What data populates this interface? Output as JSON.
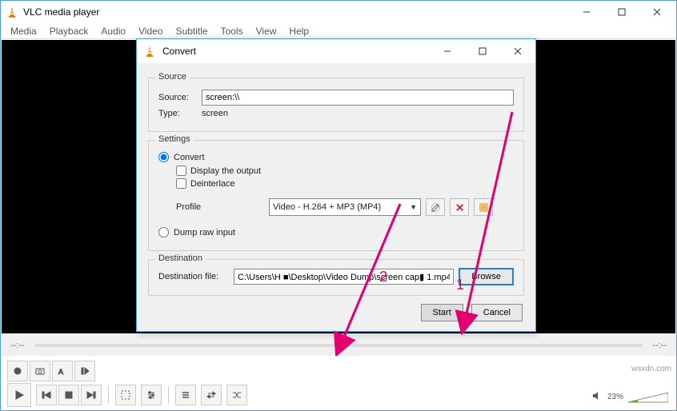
{
  "main": {
    "title": "VLC media player",
    "menu": [
      "Media",
      "Playback",
      "Audio",
      "Video",
      "Subtitle",
      "Tools",
      "View",
      "Help"
    ],
    "time_left": "--:--",
    "time_right": "--:--",
    "volume_pct": "23%"
  },
  "dialog": {
    "title": "Convert",
    "source_box": "Source",
    "source_label": "Source:",
    "source_value": "screen:\\\\",
    "type_label": "Type:",
    "type_value": "screen",
    "settings_box": "Settings",
    "convert_radio": "Convert",
    "display_output_chk": "Display the output",
    "deinterlace_chk": "Deinterlace",
    "profile_label": "Profile",
    "profile_value": "Video - H.264 + MP3 (MP4)",
    "dump_radio": "Dump raw input",
    "dest_box": "Destination",
    "dest_label": "Destination file:",
    "dest_value": "C:\\Users\\H ■\\Desktop\\Video Dump\\screen cap▮ 1.mp4",
    "browse_btn": "Browse",
    "start_btn": "Start",
    "cancel_btn": "Cancel"
  },
  "annotations": {
    "label1": "1",
    "label2": "2"
  },
  "watermark": "wsxdn.com"
}
